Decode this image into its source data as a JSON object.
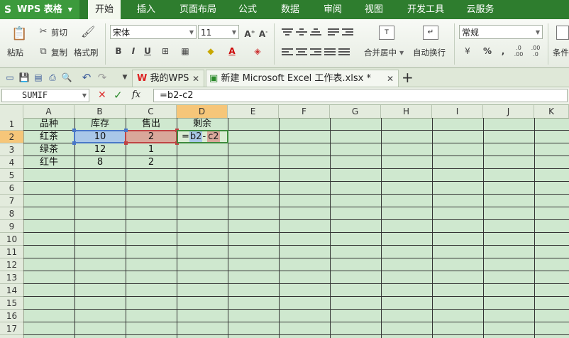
{
  "app": {
    "name": "WPS 表格"
  },
  "menu_tabs": [
    "开始",
    "插入",
    "页面布局",
    "公式",
    "数据",
    "审阅",
    "视图",
    "开发工具",
    "云服务"
  ],
  "ribbon": {
    "paste": "粘贴",
    "cut": "剪切",
    "copy": "复制",
    "format_painter": "格式刷",
    "font_name": "宋体",
    "font_size": "11",
    "merge_center": "合并居中",
    "wrap_text": "自动换行",
    "number_format": "常规",
    "conditional": "条件"
  },
  "doc_tabs": [
    {
      "label": "我的WPS"
    },
    {
      "label": "新建 Microsoft Excel 工作表.xlsx *"
    }
  ],
  "formula_bar": {
    "name_box": "SUMIF",
    "fx": "fx",
    "formula": "=b2-c2"
  },
  "columns": [
    "A",
    "B",
    "C",
    "D",
    "E",
    "F",
    "G",
    "H",
    "I",
    "J",
    "K"
  ],
  "rows": [
    "1",
    "2",
    "3",
    "4",
    "5",
    "6",
    "7",
    "8",
    "9",
    "10",
    "11",
    "12",
    "13",
    "14",
    "15",
    "16",
    "17"
  ],
  "table": {
    "headers": [
      "品种",
      "库存",
      "售出",
      "剩余"
    ],
    "data": [
      [
        "红茶",
        "10",
        "2"
      ],
      [
        "绿茶",
        "12",
        "1"
      ],
      [
        "红牛",
        "8",
        "2"
      ]
    ],
    "editing_cell": {
      "eq": "=",
      "ref1": "b2",
      "minus": "-",
      "ref2": "c2"
    }
  },
  "colors": {
    "menubar": "#2e7d2e",
    "sheet_bg": "#cfe8cf",
    "ref1_highlight": "#a9c7e8",
    "ref2_highlight": "#d9a79a",
    "header_selected": "#f6c679"
  }
}
